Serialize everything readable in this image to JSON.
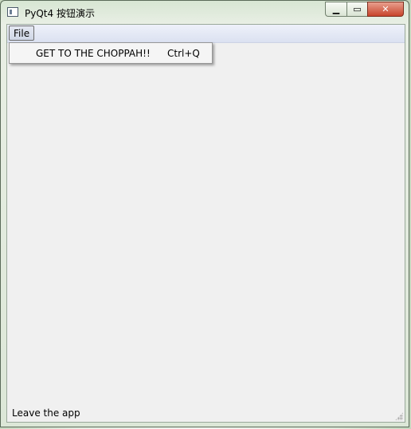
{
  "window": {
    "title": "PyQt4 按钮演示",
    "controls": {
      "minimize_icon": "minimize-icon",
      "maximize_icon": "maximize-icon",
      "close_icon": "close-icon",
      "minimize_glyph": "▁",
      "maximize_glyph": "▭",
      "close_glyph": "✕"
    }
  },
  "menubar": {
    "file_label": "File"
  },
  "file_menu": {
    "items": [
      {
        "label": "GET TO THE CHOPPAH!!",
        "shortcut": "Ctrl+Q"
      }
    ]
  },
  "statusbar": {
    "message": "Leave the app"
  },
  "colors": {
    "client_background": "#f0f0f0",
    "close_button": "#c8442c",
    "menubar": "#dbe1f1"
  }
}
